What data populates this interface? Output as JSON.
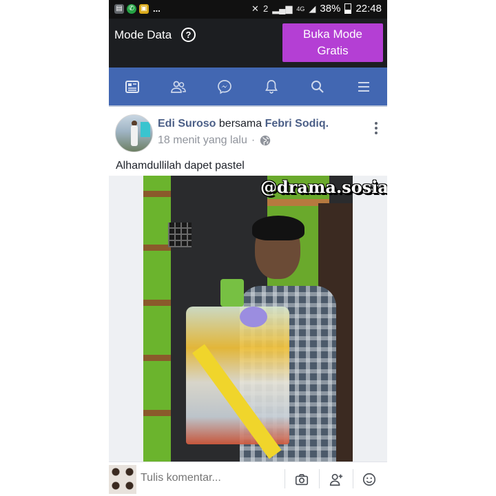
{
  "status_bar": {
    "battery_percent": "38%",
    "time": "22:48",
    "more_indicator": "...",
    "sim_label": "2",
    "network_label": "4G"
  },
  "mode_bar": {
    "label": "Mode Data",
    "help_glyph": "?",
    "button_line1": "Buka Mode",
    "button_line2": "Gratis"
  },
  "nav": {
    "items": [
      "news-feed-icon",
      "friends-icon",
      "messenger-icon",
      "notifications-icon",
      "search-icon",
      "menu-icon"
    ]
  },
  "post": {
    "author": "Edi Suroso",
    "with_text": "bersama",
    "tagged": "Febri Sodiq.",
    "time": "18 menit yang lalu",
    "separator": "·",
    "text": "Alhamdullilah dapet pastel",
    "watermark": "@drama.sosialmedia"
  },
  "comment_bar": {
    "placeholder": "Tulis komentar..."
  },
  "colors": {
    "nav_blue": "#4267b2",
    "button_purple": "#b43fd4",
    "mode_bar_bg": "#1c1e21",
    "link_blue": "#4b5f87"
  }
}
